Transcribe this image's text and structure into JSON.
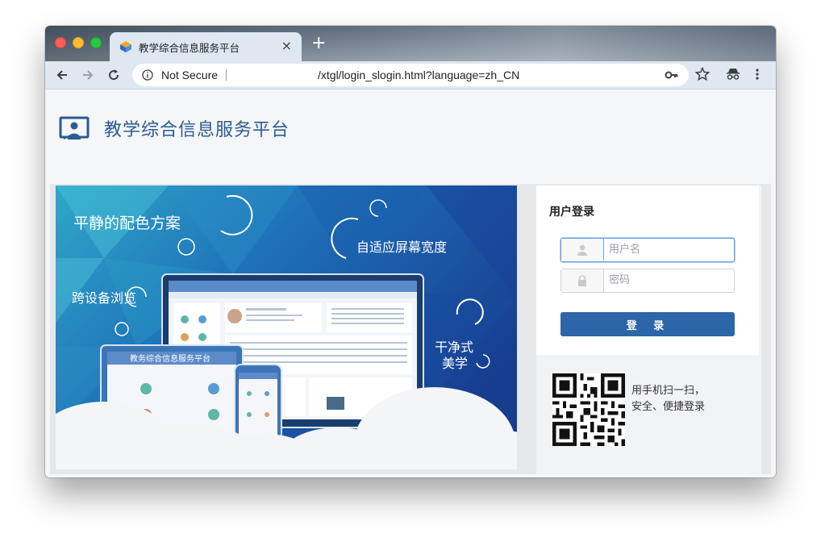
{
  "browser": {
    "tab_title": "教学综合信息服务平台",
    "tab_close": "×",
    "new_tab": "+",
    "security_label": "Not Secure",
    "url": "/xtgl/login_slogin.html?language=zh_CN",
    "icons": [
      "back-arrow-icon",
      "forward-arrow-icon",
      "reload-icon",
      "info-icon",
      "key-icon",
      "star-icon",
      "incognito-icon",
      "menu-icon"
    ]
  },
  "header": {
    "title": "教学综合信息服务平台"
  },
  "banner": {
    "text1": "平静的配色方案",
    "text2": "自适应屏幕宽度",
    "text3": "跨设备浏览",
    "text4a": "干净式",
    "text4b": "美学",
    "mock_title": "教务综合信息服务平台"
  },
  "login": {
    "title": "用户登录",
    "username_placeholder": "用户名",
    "password_placeholder": "密码",
    "submit_label": "登 录"
  },
  "qr": {
    "line1": "用手机扫一扫，",
    "line2": "安全、便捷登录"
  },
  "colors": {
    "brand_blue": "#2c66a9",
    "title_blue": "#2b5b92"
  }
}
